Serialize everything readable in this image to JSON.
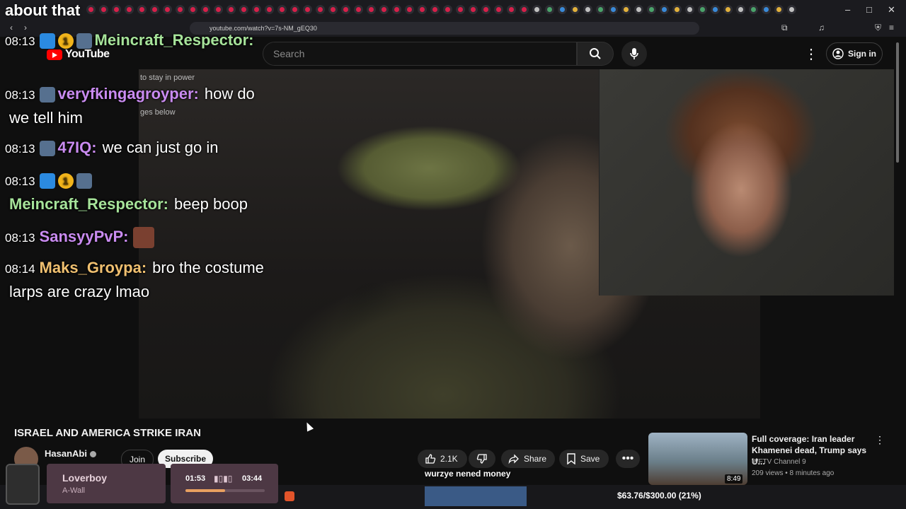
{
  "browser": {
    "url": "youtube.com/watch?v=7s-NM_gEQ30",
    "window_controls": [
      "–",
      "□",
      "✕"
    ]
  },
  "youtube": {
    "logo_text": "YouTube",
    "search_placeholder": "Search",
    "sign_in": "Sign in"
  },
  "video": {
    "title": "ISRAEL AND AMERICA STRIKE IRAN",
    "overlay_text_1": "to stay in power",
    "overlay_text_2": "ges below",
    "caption": "wurzye nened money"
  },
  "channel": {
    "name": "HasanAbi",
    "join": "Join",
    "subscribe": "Subscribe"
  },
  "actions": {
    "likes": "2.1K",
    "share": "Share",
    "save": "Save"
  },
  "recommended": {
    "title": "Full coverage: Iran leader Khamenei dead, Trump says U...",
    "channel": "WFTV Channel 9",
    "meta": "209 views • 8 minutes ago",
    "duration": "8:49"
  },
  "chat": {
    "top_text": "about that",
    "messages": [
      {
        "time": "08:13",
        "user": "Meincraft_Respector:",
        "text": "",
        "color": "#a6e39a"
      },
      {
        "time": "08:13",
        "user": "veryfkingagroyper:",
        "text": "how do",
        "color": "#c98bf0"
      },
      {
        "time": "",
        "user": "",
        "text": "we tell him",
        "color": "#ffffff"
      },
      {
        "time": "08:13",
        "user": "47IQ:",
        "text": "we can just go in",
        "color": "#c98bf0"
      },
      {
        "time": "08:13",
        "user": "",
        "text": "",
        "color": "#ffffff"
      },
      {
        "time": "",
        "user": "Meincraft_Respector:",
        "text": "beep boop",
        "color": "#a6e39a"
      },
      {
        "time": "08:13",
        "user": "SansyyPvP:",
        "text": "",
        "color": "#c98bf0"
      },
      {
        "time": "08:14",
        "user": "Maks_Groypa:",
        "text": "bro the costume",
        "color": "#f0c070"
      },
      {
        "time": "",
        "user": "",
        "text": "larps are crazy lmao",
        "color": "#ffffff"
      }
    ]
  },
  "music": {
    "title": "Loverboy",
    "artist": "A-Wall",
    "current": "01:53",
    "total": "03:44",
    "progress": 0.5
  },
  "goal": {
    "text": "$63.76/$300.00 (21%)",
    "percent": 21
  }
}
